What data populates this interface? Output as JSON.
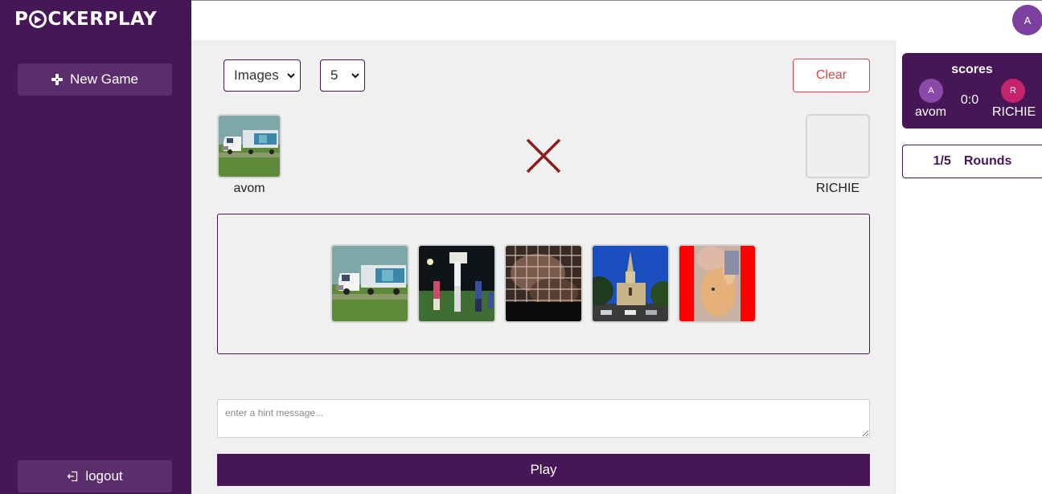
{
  "app": {
    "logo_left": "P",
    "logo_right": "CKERPLAY"
  },
  "sidebar": {
    "new_game_label": "New Game",
    "logout_label": "logout"
  },
  "topbar": {
    "avatar_initial": "A"
  },
  "controls": {
    "type_select_value": "Images",
    "count_select_value": "5",
    "clear_label": "Clear"
  },
  "players": {
    "left_name": "avom",
    "right_name": "RICHIE",
    "left_selected_image": "truck"
  },
  "image_pool": [
    "truck",
    "stadium-crowd",
    "caged-animal",
    "church",
    "person-with-kitten"
  ],
  "hint": {
    "placeholder": "enter a hint message..."
  },
  "play_label": "Play",
  "scores": {
    "title": "scores",
    "player_a_initial": "A",
    "player_a_name": "avom",
    "player_r_initial": "R",
    "player_r_name": "RICHIE",
    "score": "0:0"
  },
  "rounds": {
    "progress": "1/5",
    "label": "Rounds"
  },
  "colors": {
    "brand": "#461656",
    "sidebar_button": "#5b2d6c",
    "clear": "#e04545",
    "cross": "#8e1c1c"
  }
}
